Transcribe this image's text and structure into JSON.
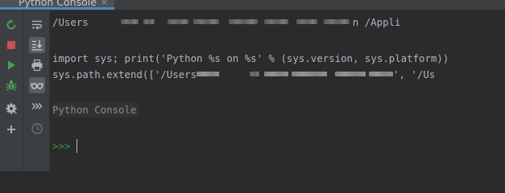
{
  "tab": {
    "title": "Python Console",
    "close_glyph": "×"
  },
  "left_toolbar": [
    {
      "name": "rerun-icon",
      "color": "#499c54"
    },
    {
      "name": "stop-icon",
      "color": "#c75450"
    },
    {
      "name": "run-icon",
      "color": "#499c54"
    },
    {
      "name": "debug-icon",
      "color": "#499c54"
    },
    {
      "name": "settings-icon",
      "color": "#afb1b3"
    },
    {
      "name": "add-icon",
      "color": "#afb1b3"
    }
  ],
  "right_toolbar": [
    {
      "name": "soft-wrap-icon"
    },
    {
      "name": "scroll-to-end-icon",
      "selected": true
    },
    {
      "name": "print-icon"
    },
    {
      "name": "show-variables-icon",
      "selected": true
    },
    {
      "name": "execute-history-icon"
    },
    {
      "name": "history-icon"
    }
  ],
  "console": {
    "line1_start": "/Users",
    "line1_end": "n /Appli",
    "line2": "import sys; print('Python %s on %s' % (sys.version, sys.platform))",
    "line3_start": "sys.path.extend(['/Users",
    "line3_end": "', '/Us",
    "banner": "Python Console",
    "prompt": ">>>"
  }
}
